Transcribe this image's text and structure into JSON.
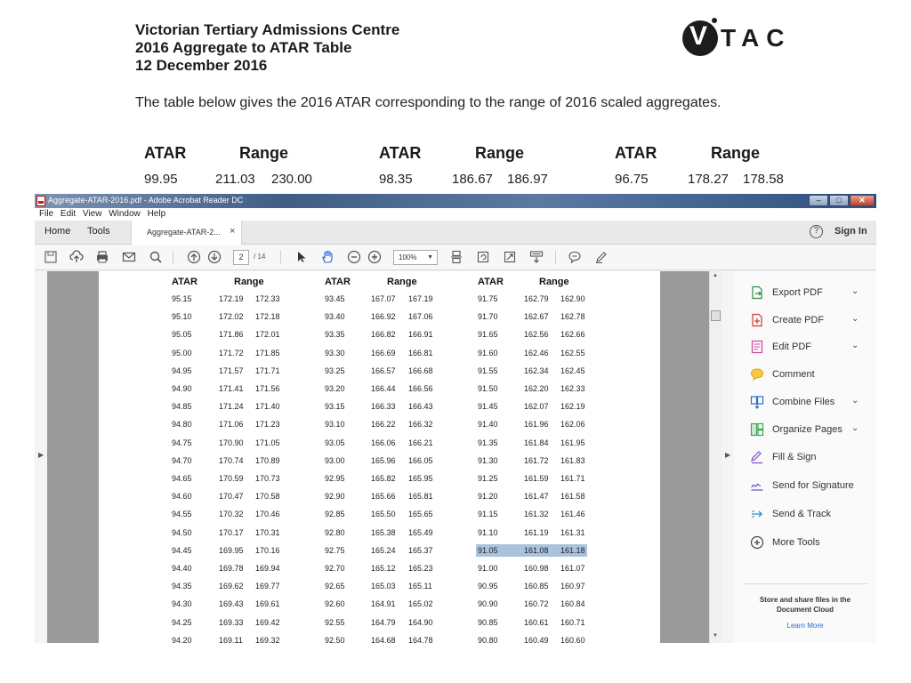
{
  "doc": {
    "title1": "Victorian Tertiary Admissions Centre",
    "title2": "2016 Aggregate to ATAR Table",
    "date": "12 December 2016",
    "intro": "The table below gives the 2016 ATAR corresponding to the range of 2016 scaled aggregates.",
    "logo_text": "TAC",
    "logo_letter": "V",
    "big_headers": [
      "ATAR",
      "Range",
      "ATAR",
      "Range",
      "ATAR",
      "Range"
    ],
    "big_values": [
      "99.95",
      "211.03",
      "230.00",
      "98.35",
      "186.67",
      "186.97",
      "96.75",
      "178.27",
      "178.58"
    ]
  },
  "window": {
    "title": "Aggregate-ATAR-2016.pdf - Adobe Acrobat Reader DC",
    "min": "–",
    "max": "□",
    "close": "✕",
    "menu": [
      "File",
      "Edit",
      "View",
      "Window",
      "Help"
    ],
    "tab_home": "Home",
    "tab_tools": "Tools",
    "doc_tab": "Aggregate-ATAR-2...",
    "doc_tab_close": "×",
    "help": "?",
    "sign_in": "Sign In"
  },
  "toolbar": {
    "page_current": "2",
    "page_total": "/ 14",
    "zoom": "100%",
    "icons": [
      "save-icon",
      "upload-icon",
      "print-icon",
      "email-icon",
      "search-icon",
      "prev-page-icon",
      "next-page-icon",
      "select-cursor-icon",
      "hand-tool-icon",
      "zoom-out-icon",
      "zoom-in-icon",
      "fit-page-icon",
      "rotate-icon",
      "full-screen-icon",
      "read-mode-icon",
      "comment-icon",
      "highlight-pen-icon"
    ]
  },
  "table": {
    "headers": [
      "ATAR",
      "Range",
      "ATAR",
      "Range",
      "ATAR",
      "Range"
    ],
    "rows": [
      [
        "95.15",
        "172.19",
        "172.33",
        "93.45",
        "167.07",
        "167.19",
        "91.75",
        "162.79",
        "162.90"
      ],
      [
        "95.10",
        "172.02",
        "172.18",
        "93.40",
        "166.92",
        "167.06",
        "91.70",
        "162.67",
        "162.78"
      ],
      [
        "95.05",
        "171.86",
        "172.01",
        "93.35",
        "166.82",
        "166.91",
        "91.65",
        "162.56",
        "162.66"
      ],
      [
        "95.00",
        "171.72",
        "171.85",
        "93.30",
        "166.69",
        "166.81",
        "91.60",
        "162.46",
        "162.55"
      ],
      [
        "94.95",
        "171.57",
        "171.71",
        "93.25",
        "166.57",
        "166.68",
        "91.55",
        "162.34",
        "162.45"
      ],
      [
        "94.90",
        "171.41",
        "171.56",
        "93.20",
        "166.44",
        "166.56",
        "91.50",
        "162.20",
        "162.33"
      ],
      [
        "94.85",
        "171.24",
        "171.40",
        "93.15",
        "166.33",
        "166.43",
        "91.45",
        "162.07",
        "162.19"
      ],
      [
        "94.80",
        "171.06",
        "171.23",
        "93.10",
        "166.22",
        "166.32",
        "91.40",
        "161.96",
        "162.06"
      ],
      [
        "94.75",
        "170.90",
        "171.05",
        "93.05",
        "166.06",
        "166.21",
        "91.35",
        "161.84",
        "161.95"
      ],
      [
        "94.70",
        "170.74",
        "170.89",
        "93.00",
        "165.96",
        "166.05",
        "91.30",
        "161.72",
        "161.83"
      ],
      [
        "94.65",
        "170.59",
        "170.73",
        "92.95",
        "165.82",
        "165.95",
        "91.25",
        "161.59",
        "161.71"
      ],
      [
        "94.60",
        "170.47",
        "170.58",
        "92.90",
        "165.66",
        "165.81",
        "91.20",
        "161.47",
        "161.58"
      ],
      [
        "94.55",
        "170.32",
        "170.46",
        "92.85",
        "165.50",
        "165.65",
        "91.15",
        "161.32",
        "161.46"
      ],
      [
        "94.50",
        "170.17",
        "170.31",
        "92.80",
        "165.38",
        "165.49",
        "91.10",
        "161.19",
        "161.31"
      ],
      [
        "94.45",
        "169.95",
        "170.16",
        "92.75",
        "165.24",
        "165.37",
        "91.05",
        "161.08",
        "161.18"
      ],
      [
        "94.40",
        "169.78",
        "169.94",
        "92.70",
        "165.12",
        "165.23",
        "91.00",
        "160.98",
        "161.07"
      ],
      [
        "94.35",
        "169.62",
        "169.77",
        "92.65",
        "165.03",
        "165.11",
        "90.95",
        "160.85",
        "160.97"
      ],
      [
        "94.30",
        "169.43",
        "169.61",
        "92.60",
        "164.91",
        "165.02",
        "90.90",
        "160.72",
        "160.84"
      ],
      [
        "94.25",
        "169.33",
        "169.42",
        "92.55",
        "164.79",
        "164.90",
        "90.85",
        "160.61",
        "160.71"
      ],
      [
        "94.20",
        "169.11",
        "169.32",
        "92.50",
        "164.68",
        "164.78",
        "90.80",
        "160.49",
        "160.60"
      ]
    ],
    "highlighted_row": 14
  },
  "panel": {
    "items": [
      {
        "label": "Export PDF",
        "icon": "export-pdf-icon",
        "chevron": "⌄",
        "color": "#2f8f3e"
      },
      {
        "label": "Create PDF",
        "icon": "create-pdf-icon",
        "chevron": "⌄",
        "color": "#d03b2f"
      },
      {
        "label": "Edit PDF",
        "icon": "edit-pdf-icon",
        "chevron": "⌄",
        "color": "#d2459a"
      },
      {
        "label": "Comment",
        "icon": "comment-icon",
        "chevron": "",
        "color": "#e8a400"
      },
      {
        "label": "Combine Files",
        "icon": "combine-files-icon",
        "chevron": "⌄",
        "color": "#2a6bd1"
      },
      {
        "label": "Organize Pages",
        "icon": "organize-pages-icon",
        "chevron": "⌄",
        "color": "#3aa54f"
      },
      {
        "label": "Fill & Sign",
        "icon": "fill-sign-icon",
        "chevron": "",
        "color": "#7a4fc8"
      },
      {
        "label": "Send for Signature",
        "icon": "send-signature-icon",
        "chevron": "",
        "color": "#5b4fc8"
      },
      {
        "label": "Send & Track",
        "icon": "send-track-icon",
        "chevron": "",
        "color": "#2a8fd1"
      },
      {
        "label": "More Tools",
        "icon": "more-tools-icon",
        "chevron": "",
        "color": "#444444"
      }
    ],
    "cloud_text": "Store and share files in the Document Cloud",
    "learn_more": "Learn More"
  }
}
